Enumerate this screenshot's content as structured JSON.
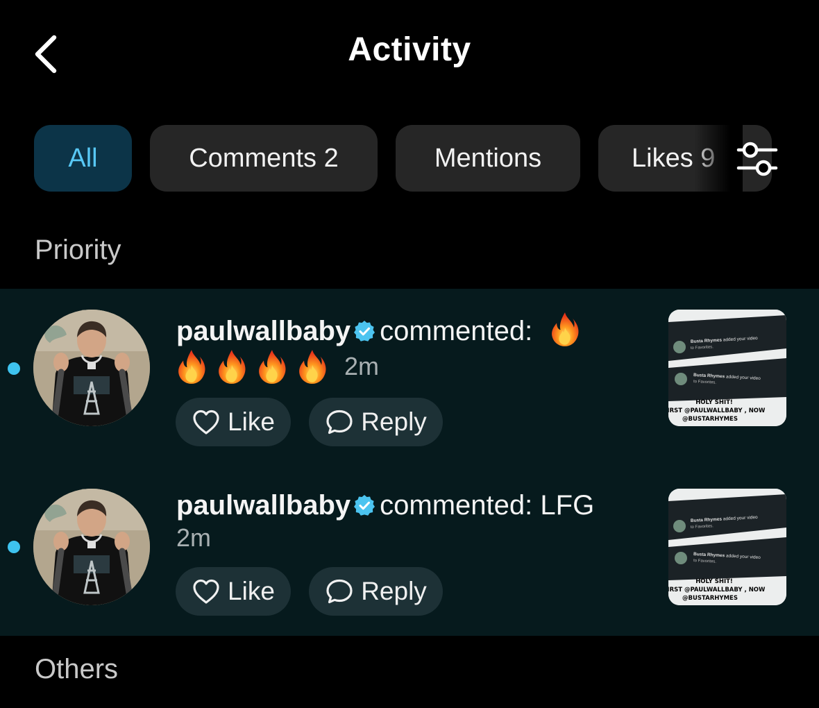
{
  "header": {
    "title": "Activity"
  },
  "tabs": [
    {
      "label": "All",
      "active": true
    },
    {
      "label": "Comments 2",
      "active": false
    },
    {
      "label": "Mentions",
      "active": false
    },
    {
      "label": "Likes 9",
      "active": false
    }
  ],
  "sections": {
    "priority": "Priority",
    "others": "Others"
  },
  "activity": [
    {
      "username": "paulwallbaby",
      "verified": true,
      "action": "commented:",
      "comment_text": "",
      "comment_emoji": [
        "fire",
        "fire",
        "fire",
        "fire",
        "fire"
      ],
      "time": "2m",
      "unread": true,
      "like_label": "Like",
      "reply_label": "Reply",
      "thumbnail": {
        "notif1_name": "Busta Rhymes",
        "notif1_text": "added your video",
        "notif1_sub": "to Favorites.",
        "notif2_name": "Busta Rhymes",
        "notif2_text": "added your video",
        "notif2_sub": "to Favorites.",
        "caption1": "HOLY SHIT!",
        "caption2": "FIRST @PAULWALLBABY , NOW",
        "caption3": "@BUSTARHYMES"
      }
    },
    {
      "username": "paulwallbaby",
      "verified": true,
      "action": "commented:",
      "comment_text": "LFG",
      "time": "2m",
      "unread": true,
      "like_label": "Like",
      "reply_label": "Reply",
      "thumbnail": {
        "notif1_name": "Busta Rhymes",
        "notif1_text": "added your video",
        "notif1_sub": "to Favorites.",
        "notif2_name": "Busta Rhymes",
        "notif2_text": "added your video",
        "notif2_sub": "to Favorites.",
        "caption1": "HOLY SHIT!",
        "caption2": "FIRST @PAULWALLBABY , NOW",
        "caption3": "@BUSTARHYMES"
      }
    }
  ],
  "colors": {
    "background": "#000000",
    "priority_panel": "#061a1d",
    "active_tab_bg": "#0c3448",
    "active_tab_text": "#58c8f5",
    "unread_dot": "#3ec3ef",
    "verified_badge": "#4cc4f0"
  },
  "icons": {
    "back": "chevron-left-icon",
    "filter": "sliders-icon",
    "verified": "verified-badge-icon",
    "like": "heart-icon",
    "reply": "speech-bubble-icon",
    "emoji": "fire-emoji"
  }
}
